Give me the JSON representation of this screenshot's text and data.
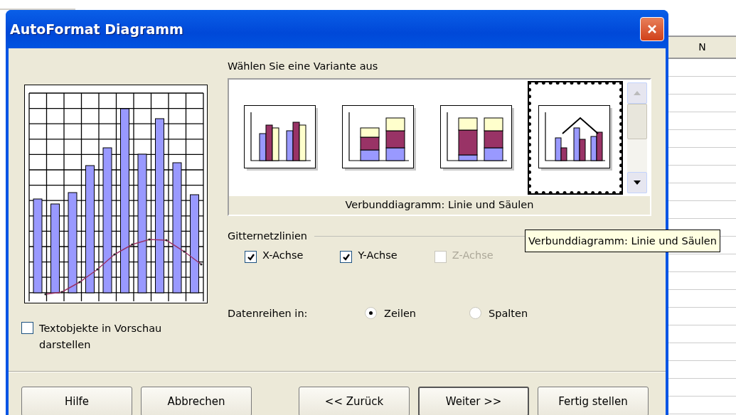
{
  "window": {
    "title": "AutoFormat Diagramm"
  },
  "spreadsheet": {
    "column_header": "N"
  },
  "variant_prompt": "Wählen Sie eine Variante aus",
  "variants": [
    {
      "kind": "clustered",
      "selected": false
    },
    {
      "kind": "stacked",
      "selected": false
    },
    {
      "kind": "percent",
      "selected": false
    },
    {
      "kind": "combo",
      "selected": true
    }
  ],
  "variant_caption": "Verbunddiagramm: Linie und Säulen",
  "tooltip": "Verbunddiagramm: Linie und Säulen",
  "gridlines": {
    "title": "Gitternetzlinien",
    "axes": [
      {
        "label": "X-Achse",
        "checked": true,
        "disabled": false
      },
      {
        "label": "Y-Achse",
        "checked": true,
        "disabled": false
      },
      {
        "label": "Z-Achse",
        "checked": false,
        "disabled": true
      }
    ]
  },
  "show_text_in_preview": {
    "label": "Textobjekte in Vorschau darstellen",
    "checked": false
  },
  "series_in": {
    "label": "Datenreihen in:",
    "options": [
      {
        "label": "Zeilen",
        "selected": true
      },
      {
        "label": "Spalten",
        "selected": false
      }
    ]
  },
  "buttons": [
    {
      "label": "Hilfe",
      "default": false
    },
    {
      "label": "Abbrechen",
      "default": false
    },
    {
      "label": "<< Zurück",
      "default": false
    },
    {
      "label": "Weiter >>",
      "default": true
    },
    {
      "label": "Fertig stellen",
      "default": false
    }
  ]
}
